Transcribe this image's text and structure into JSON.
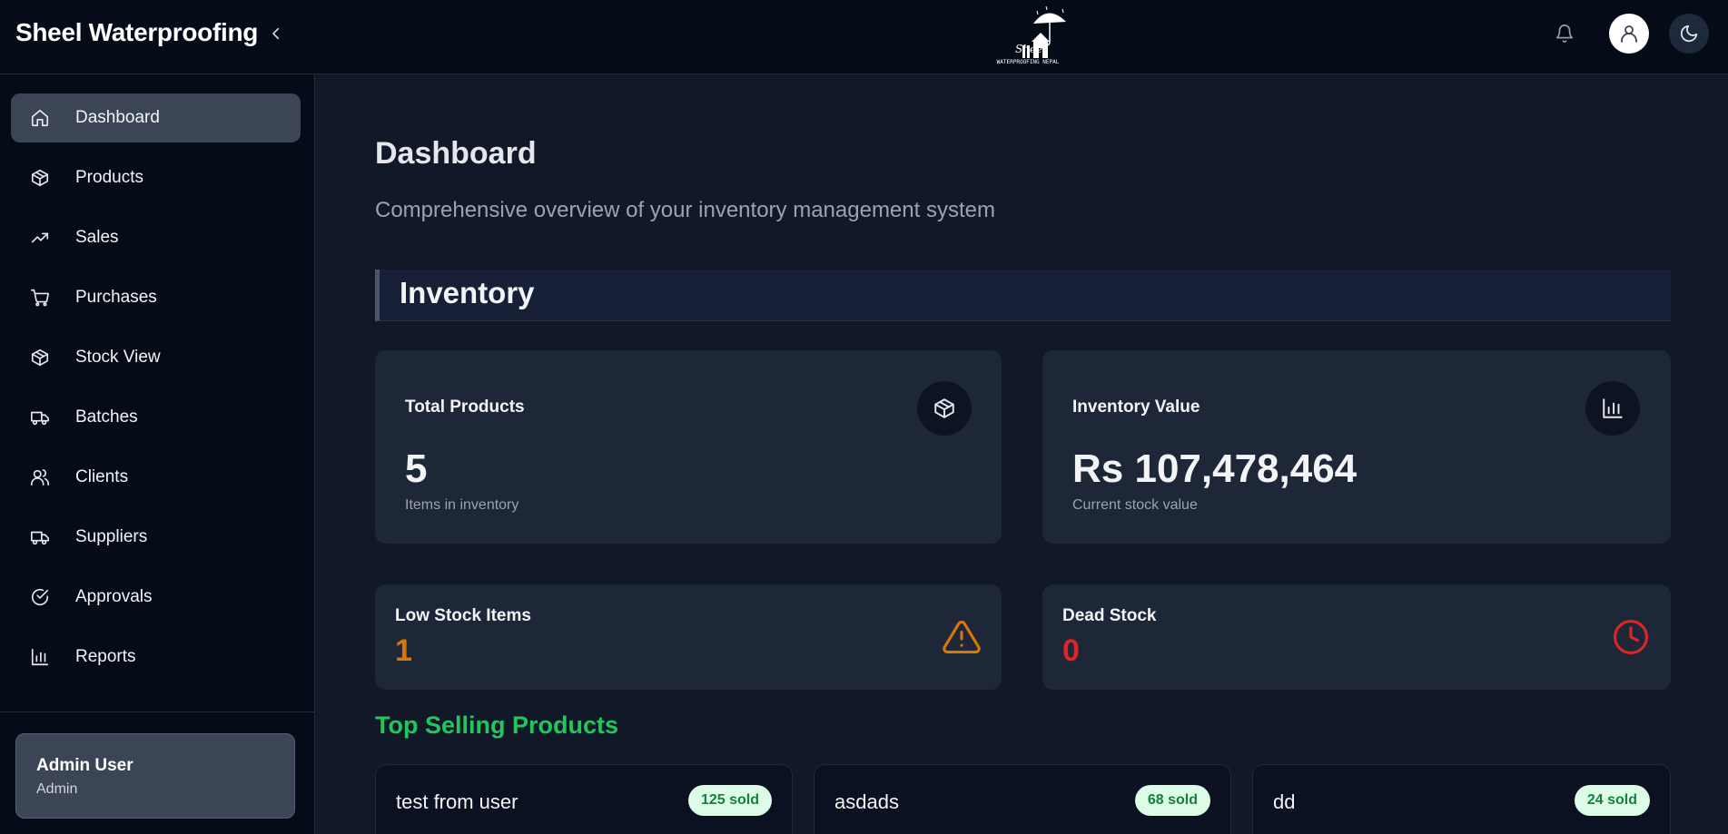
{
  "app": {
    "brand": "Sheel Waterproofing"
  },
  "logo": {
    "top_text": "Sheel",
    "bottom_text": "WATERPROOFING NEPAL"
  },
  "sidebar": {
    "items": [
      {
        "label": "Dashboard",
        "icon": "home-icon",
        "active": true
      },
      {
        "label": "Products",
        "icon": "box-icon",
        "active": false
      },
      {
        "label": "Sales",
        "icon": "trending-up-icon",
        "active": false
      },
      {
        "label": "Purchases",
        "icon": "cart-icon",
        "active": false
      },
      {
        "label": "Stock View",
        "icon": "box-icon",
        "active": false
      },
      {
        "label": "Batches",
        "icon": "truck-icon",
        "active": false
      },
      {
        "label": "Clients",
        "icon": "users-icon",
        "active": false
      },
      {
        "label": "Suppliers",
        "icon": "truck-icon",
        "active": false
      },
      {
        "label": "Approvals",
        "icon": "check-circle-icon",
        "active": false
      },
      {
        "label": "Reports",
        "icon": "bar-chart-icon",
        "active": false
      }
    ],
    "user": {
      "name": "Admin User",
      "role": "Admin"
    }
  },
  "page": {
    "title": "Dashboard",
    "subtitle": "Comprehensive overview of your inventory management system"
  },
  "inventory": {
    "section_title": "Inventory",
    "total_products": {
      "label": "Total Products",
      "value": "5",
      "caption": "Items in inventory",
      "icon": "box-icon"
    },
    "inventory_value": {
      "label": "Inventory Value",
      "value": "Rs 107,478,464",
      "caption": "Current stock value",
      "icon": "bar-chart-icon"
    },
    "low_stock": {
      "label": "Low Stock Items",
      "value": "1",
      "icon": "warning-icon"
    },
    "dead_stock": {
      "label": "Dead Stock",
      "value": "0",
      "icon": "clock-icon"
    }
  },
  "top_selling": {
    "title": "Top Selling Products",
    "products": [
      {
        "name": "test from user",
        "sold": "125 sold"
      },
      {
        "name": "asdads",
        "sold": "68 sold"
      },
      {
        "name": "dd",
        "sold": "24 sold"
      }
    ]
  },
  "colors": {
    "accent_green": "#22c55e",
    "warning_orange": "#d97706",
    "danger_red": "#dc2626",
    "active_nav": "#3b4556"
  }
}
